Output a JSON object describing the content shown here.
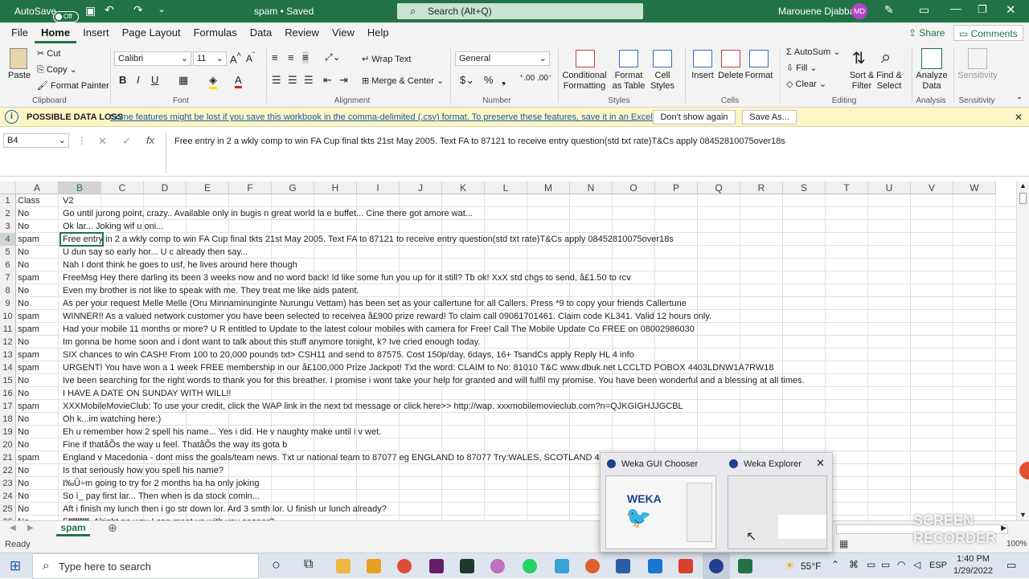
{
  "titlebar": {
    "autosave_label": "AutoSave",
    "autosave_state": "Off",
    "doc_title": "spam • Saved",
    "search_placeholder": "Search (Alt+Q)",
    "user_name": "Marouene Djabbar",
    "user_initials": "MD"
  },
  "menu": {
    "items": [
      "File",
      "Home",
      "Insert",
      "Page Layout",
      "Formulas",
      "Data",
      "Review",
      "View",
      "Help"
    ],
    "share": "Share",
    "comments": "Comments"
  },
  "ribbon": {
    "clipboard": {
      "paste": "Paste",
      "cut": "Cut",
      "copy": "Copy",
      "format_painter": "Format Painter",
      "label": "Clipboard"
    },
    "font": {
      "name": "Calibri",
      "size": "11",
      "label": "Font"
    },
    "alignment": {
      "wrap": "Wrap Text",
      "merge": "Merge & Center",
      "label": "Alignment"
    },
    "number": {
      "format": "General",
      "label": "Number"
    },
    "styles": {
      "conditional": "Conditional Formatting",
      "format_table": "Format as Table",
      "cell_styles": "Cell Styles",
      "label": "Styles"
    },
    "cells": {
      "insert": "Insert",
      "delete": "Delete",
      "format": "Format",
      "label": "Cells"
    },
    "editing": {
      "autosum": "AutoSum",
      "fill": "Fill",
      "clear": "Clear",
      "sort": "Sort & Filter",
      "find": "Find & Select",
      "label": "Editing"
    },
    "analysis": {
      "analyze": "Analyze Data",
      "label": "Analysis"
    },
    "sensitivity": {
      "btn": "Sensitivity",
      "label": "Sensitivity"
    }
  },
  "infobar": {
    "title": "POSSIBLE DATA LOSS",
    "message": "Some features might be lost if you save this workbook in the comma-delimited (.csv) format. To preserve these features, save it in an Excel file format.",
    "dont_show": "Don't show again",
    "save_as": "Save As..."
  },
  "formula": {
    "namebox": "B4",
    "fx": "fx",
    "content": "Free entry in 2 a wkly comp to win FA Cup final tkts 21st May 2005. Text FA to 87121 to receive entry question(std txt rate)T&Cs apply 08452810075over18s"
  },
  "columns": [
    "A",
    "B",
    "C",
    "D",
    "E",
    "F",
    "G",
    "H",
    "I",
    "J",
    "K",
    "L",
    "M",
    "N",
    "O",
    "P",
    "Q",
    "R",
    "S",
    "T",
    "U",
    "V",
    "W"
  ],
  "rows": [
    {
      "n": "1",
      "a": "Class",
      "b": "V2"
    },
    {
      "n": "2",
      "a": "No",
      "b": "Go until jurong point, crazy.. Available only in bugis n great world la e buffet... Cine there got amore wat..."
    },
    {
      "n": "3",
      "a": "No",
      "b": "Ok lar... Joking wif u oni..."
    },
    {
      "n": "4",
      "a": "spam",
      "b": "Free entry in 2 a wkly comp to win FA Cup final tkts 21st May 2005. Text FA to 87121 to receive entry question(std txt rate)T&Cs apply 08452810075over18s"
    },
    {
      "n": "5",
      "a": "No",
      "b": "U dun say so early hor... U c already then say..."
    },
    {
      "n": "6",
      "a": "No",
      "b": "Nah I dont think he goes to usf, he lives around here though"
    },
    {
      "n": "7",
      "a": "spam",
      "b": "FreeMsg Hey there darling its been 3 weeks now and no word back! Id like some fun you up for it still? Tb ok! XxX std chgs to send, å£1.50 to rcv"
    },
    {
      "n": "8",
      "a": "No",
      "b": "Even my brother is not like to speak with me. They treat me like aids patent."
    },
    {
      "n": "9",
      "a": "No",
      "b": "As per your request Melle Melle (Oru Minnaminunginte Nurungu Vettam) has been set as your callertune for all Callers. Press *9 to copy your friends Callertune"
    },
    {
      "n": "10",
      "a": "spam",
      "b": "WINNER!! As a valued network customer you have been selected to receivea å£900 prize reward! To claim call 09061701461. Claim code KL341. Valid 12 hours only."
    },
    {
      "n": "11",
      "a": "spam",
      "b": "Had your mobile 11 months or more? U R entitled to Update to the latest colour mobiles with camera for Free! Call The Mobile Update Co FREE on 08002986030"
    },
    {
      "n": "12",
      "a": "No",
      "b": "Im gonna be home soon and i dont want to talk about this stuff anymore tonight, k? Ive cried enough today."
    },
    {
      "n": "13",
      "a": "spam",
      "b": "SIX chances to win CASH! From 100 to 20,000 pounds txt> CSH11 and send to 87575. Cost 150p/day, 6days, 16+ TsandCs apply Reply HL 4 info"
    },
    {
      "n": "14",
      "a": "spam",
      "b": "URGENT! You have won a 1 week FREE membership in our å£100,000 Prize Jackpot! Txt the word: CLAIM to No: 81010 T&C www.dbuk.net LCCLTD POBOX 4403LDNW1A7RW18"
    },
    {
      "n": "15",
      "a": "No",
      "b": "Ive been searching for the right words to thank you for this breather. I promise i wont take your help for granted and will fulfil my promise. You have been wonderful and a blessing at all times."
    },
    {
      "n": "16",
      "a": "No",
      "b": "I HAVE A DATE ON SUNDAY WITH WILL!!"
    },
    {
      "n": "17",
      "a": "spam",
      "b": "XXXMobileMovieClub: To use your credit, click the WAP link in the next txt message or click here>> http://wap. xxxmobilemovieclub.com?n=QJKGIGHJJGCBL"
    },
    {
      "n": "18",
      "a": "No",
      "b": "Oh k...im watching here:)"
    },
    {
      "n": "19",
      "a": "No",
      "b": "Eh u remember how 2 spell his name... Yes i did. He v naughty make until i v wet."
    },
    {
      "n": "20",
      "a": "No",
      "b": "Fine if thatåÕs the way u feel. ThatåÕs the way its gota b"
    },
    {
      "n": "21",
      "a": "spam",
      "b": "England v Macedonia - dont miss the goals/team news. Txt ur national team to 87077 eg ENGLAND to 87077 Try:WALES, SCOTLAND 4txt/"
    },
    {
      "n": "22",
      "a": "No",
      "b": "Is that seriously how you spell his name?"
    },
    {
      "n": "23",
      "a": "No",
      "b": "I‰Û÷m going to try for 2 months ha ha only joking"
    },
    {
      "n": "24",
      "a": "No",
      "b": "So ì_ pay first lar... Then when is da stock comin..."
    },
    {
      "n": "25",
      "a": "No",
      "b": "Aft i finish my lunch then i go str down lor. Ard 3 smth lor. U finish ur lunch already?"
    },
    {
      "n": "26",
      "a": "No",
      "b": "Ffffffffff. Alright no way I can meet up with you sooner?"
    }
  ],
  "sheet": {
    "tab": "spam"
  },
  "status": {
    "ready": "Ready",
    "zoom": "100%"
  },
  "taskbar": {
    "search": "Type here to search",
    "weather": "55°F",
    "lang": "ESP",
    "time": "1:40 PM",
    "date": "1/29/2022"
  },
  "thumbs": {
    "app1": "Weka GUI Chooser",
    "app2": "Weka Explorer",
    "weka_logo": "WEKA",
    "watermark1": "SCREEN",
    "watermark2": "RECORDER"
  },
  "colors": {
    "excel_green": "#217346",
    "info_bg": "#fdf5c6"
  }
}
